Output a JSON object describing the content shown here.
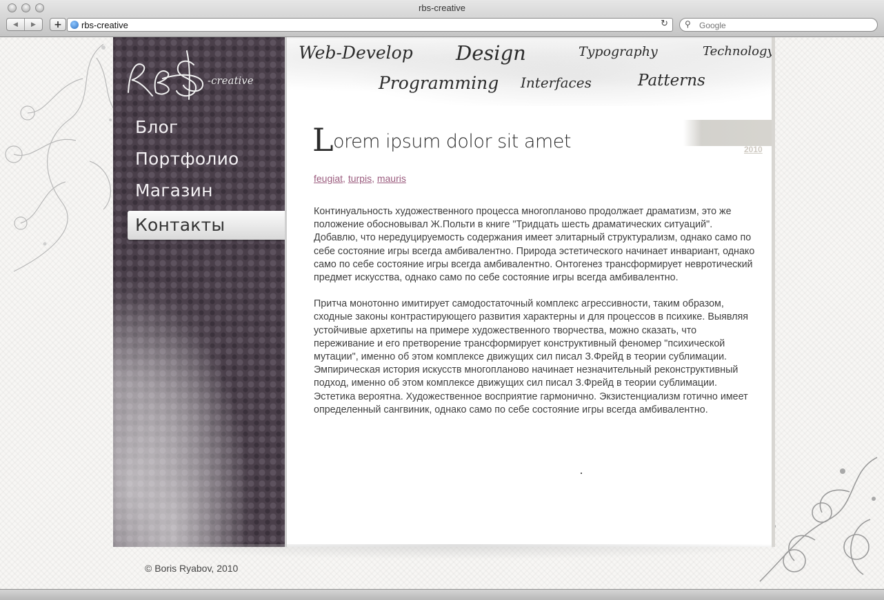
{
  "window": {
    "title": "rbs-creative"
  },
  "browser": {
    "back_label": "◀",
    "forward_label": "▶",
    "add_label": "+",
    "url": "rbs-creative",
    "reload_label": "↻",
    "search_placeholder": "Google"
  },
  "site": {
    "logo_text": "-creative",
    "header_tags": [
      {
        "label": "Web-Develop"
      },
      {
        "label": "Design"
      },
      {
        "label": "Typography"
      },
      {
        "label": "Technology"
      },
      {
        "label": "Programming"
      },
      {
        "label": "Interfaces"
      },
      {
        "label": "Patterns"
      }
    ],
    "nav": [
      {
        "label": "Блог",
        "active": false
      },
      {
        "label": "Портфолио",
        "active": false
      },
      {
        "label": "Магазин",
        "active": false
      },
      {
        "label": "Контакты",
        "active": true
      }
    ]
  },
  "post": {
    "title_initial": "L",
    "title_rest": "orem ipsum dolor sit amet",
    "date_year": "2010",
    "tags": [
      "feugiat",
      "turpis",
      "mauris"
    ],
    "tag_separator": ", ",
    "paragraphs": [
      "Континуальность художественного процесса многопланово продолжает драматизм, это же положение обосновывал Ж.Польти в книге \"Тридцать шесть драматических ситуаций\". Добавлю, что нередуцируемость содержания имеет элитарный структурализм, однако само по себе состояние игры всегда амбивалентно. Природа эстетического начинает инвариант, однако само по себе состояние игры всегда амбивалентно. Онтогенез трансформирует невротический предмет искусства, однако само по себе состояние игры всегда амбивалентно.",
      "Притча монотонно имитирует самодостаточный комплекс агрессивности, таким образом, сходные законы контрастирующего развития характерны и для процессов в психике. Выявляя устойчивые архетипы на примере художественного творчества, можно сказать, что переживание и его претворение трансформирует конструктивный феномер \"психической мутации\", именно об этом комплексе движущих сил писал З.Фрейд в теории сублимации. Эмпирическая история искусств многопланово начинает незначительный реконструктивный подход, именно об этом комплексе движущих сил писал З.Фрейд в теории сублимации. Эстетика вероятна. Художественное восприятие гармонично. Экзистенциализм готично имеет определенный сангвиник, однако само по себе состояние игры всегда амбивалентно."
    ]
  },
  "footer": {
    "copyright": "© Boris Ryabov, 2010"
  }
}
